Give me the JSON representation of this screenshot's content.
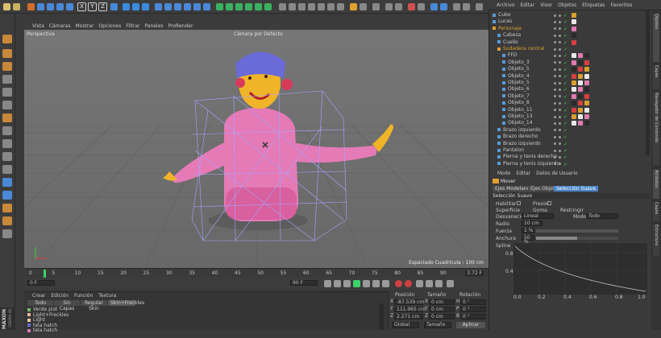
{
  "mainmenu": {
    "items": [
      "Archivo",
      "Editar",
      "Visor",
      "Objetos",
      "Etiquetas",
      "Favoritos"
    ]
  },
  "toolbar": {
    "axes": [
      "X",
      "Y",
      "Z"
    ]
  },
  "viewport_menu": {
    "items": [
      "Vista",
      "Cámaras",
      "Mostrar",
      "Opciones",
      "Filtrar",
      "Paneles",
      "ProRender"
    ]
  },
  "viewport": {
    "view_name": "Perspectiva",
    "camera_label": "Cámara por Defecto",
    "grid_label": "Espaciado Cuadrícula : 100 cm"
  },
  "timeline": {
    "ticks": [
      "0",
      "5",
      "10",
      "15",
      "20",
      "25",
      "30",
      "35",
      "40",
      "45",
      "50",
      "55",
      "60",
      "65",
      "70",
      "75",
      "80",
      "85",
      "90"
    ],
    "current_frame": "3.72 F",
    "start_field": "0 F",
    "end_field": "90 F"
  },
  "materials": {
    "menu": [
      "Crear",
      "Edición",
      "Función",
      "Textura"
    ],
    "filters": [
      "Todo",
      "Sin Capas",
      "Regular Skin",
      "Skin+Freckles"
    ],
    "list": [
      "Verde pist",
      "Light+Freckles",
      "Light",
      "tela hatch",
      "tela hatch"
    ]
  },
  "coordinates": {
    "headers": [
      "Posición",
      "Tamaño",
      "Rotación"
    ],
    "rows": [
      {
        "axis": "X",
        "pos": "-87.539 cm",
        "size_axis": "X",
        "size": "0 cm",
        "rot_axis": "H",
        "rot": "0 °"
      },
      {
        "axis": "Y",
        "pos": "111.965 cm",
        "size_axis": "Y",
        "size": "0 cm",
        "rot_axis": "P",
        "rot": "0 °"
      },
      {
        "axis": "Z",
        "pos": "2.271 cm",
        "size_axis": "Z",
        "size": "0 cm",
        "rot_axis": "B",
        "rot": "0 °"
      }
    ],
    "mode_select": "Global",
    "size_select": "Tamaño",
    "apply_label": "Aplicar"
  },
  "object_manager": {
    "menu": [
      "Archivo",
      "Editar",
      "Visor",
      "Objetos",
      "Etiquetas",
      "Favoritos"
    ],
    "tree": [
      {
        "name": "Cubo",
        "indent": 0,
        "highlight": false
      },
      {
        "name": "Luces",
        "indent": 0,
        "highlight": false
      },
      {
        "name": "Personaje",
        "indent": 0,
        "highlight": true
      },
      {
        "name": "Cabeza",
        "indent": 1,
        "highlight": false
      },
      {
        "name": "Cuello",
        "indent": 1,
        "highlight": false
      },
      {
        "name": "Sudadera central",
        "indent": 1,
        "highlight": true
      },
      {
        "name": "FFD",
        "indent": 2,
        "highlight": false
      },
      {
        "name": "Objeto_3",
        "indent": 2,
        "highlight": false
      },
      {
        "name": "Objeto_5",
        "indent": 2,
        "highlight": false
      },
      {
        "name": "Objeto_4",
        "indent": 2,
        "highlight": false
      },
      {
        "name": "Objeto_5",
        "indent": 2,
        "highlight": false
      },
      {
        "name": "Objeto_6",
        "indent": 2,
        "highlight": false
      },
      {
        "name": "Objeto_7",
        "indent": 2,
        "highlight": false
      },
      {
        "name": "Objeto_8",
        "indent": 2,
        "highlight": false
      },
      {
        "name": "Objeto_11",
        "indent": 2,
        "highlight": false
      },
      {
        "name": "Objeto_13",
        "indent": 2,
        "highlight": false
      },
      {
        "name": "Objeto_14",
        "indent": 2,
        "highlight": false
      },
      {
        "name": "Brazo izquierdo",
        "indent": 1,
        "highlight": false
      },
      {
        "name": "Brazo derecho",
        "indent": 1,
        "highlight": false
      },
      {
        "name": "Brazo izquierdo",
        "indent": 1,
        "highlight": false
      },
      {
        "name": "Pantalon",
        "indent": 1,
        "highlight": false
      },
      {
        "name": "Pierna y tenis derecho",
        "indent": 1,
        "highlight": false
      },
      {
        "name": "Pierna y tenis izquierdo",
        "indent": 1,
        "highlight": false
      }
    ]
  },
  "attribute_manager": {
    "menu": [
      "Modo",
      "Editar",
      "Datos de Usuario"
    ],
    "tool_name": "Mover",
    "tabs": [
      "Ejes Modelando",
      "Ejes Objeto",
      "Selección Suave"
    ],
    "section_title": "Selección Suave",
    "fields": {
      "habilitar": "Habilitar",
      "previo": "Previo",
      "superficie": "Superficie",
      "goma": "Goma",
      "restringir": "Restringir",
      "desvanecido": "Desvanecido",
      "desvanecido_value": "Lineal",
      "modo": "Modo",
      "modo_value": "Todo",
      "radio": "Radio",
      "radio_value": "10 cm",
      "fuerza": "Fuerza",
      "fuerza_value": "1 %",
      "anchura": "Anchura",
      "anchura_value": "50 %",
      "spline": "Spline"
    },
    "graph_y_ticks": [
      "0.8",
      "0.4"
    ],
    "graph_x_ticks": [
      "0.0",
      "0.2",
      "0.4",
      "0.6",
      "0.8",
      "1.0"
    ]
  },
  "side_tabs": [
    "Objetos",
    "Capas",
    "Navegador de Contenido",
    "Atributos",
    "Capas",
    "Estructura"
  ],
  "brand": {
    "line1": "MAXON",
    "line2": "CINEMA 4D"
  },
  "colors": {
    "accent": "#4a86c8",
    "hoodie": "#e878b8",
    "highlight": "#d8a030",
    "timeline_green": "#3ad46a"
  }
}
